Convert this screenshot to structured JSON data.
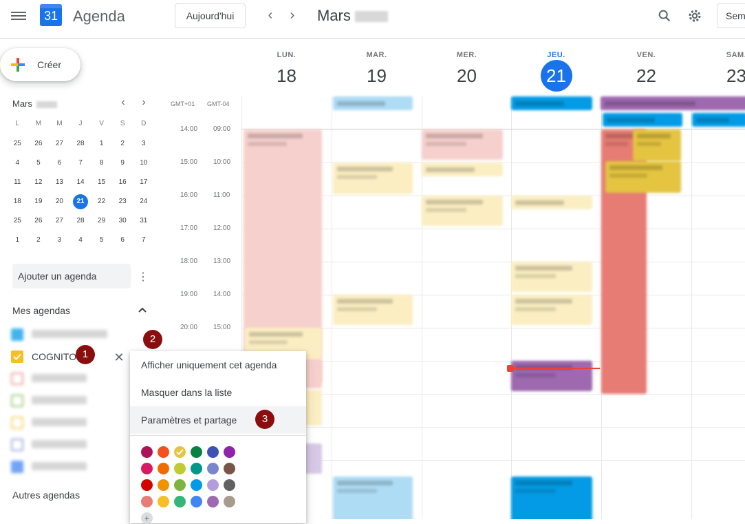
{
  "header": {
    "app_title": "Agenda",
    "logo_text": "31",
    "today_button": "Aujourd'hui",
    "prev_icon": "‹",
    "next_icon": "›",
    "month": "Mars",
    "view_button": "Sem"
  },
  "create": {
    "label": "Créer"
  },
  "mini_calendar": {
    "month": "Mars",
    "weekdays": [
      "L",
      "M",
      "M",
      "J",
      "V",
      "S",
      "D"
    ],
    "weeks": [
      [
        "25",
        "26",
        "27",
        "28",
        "1",
        "2",
        "3"
      ],
      [
        "4",
        "5",
        "6",
        "7",
        "8",
        "9",
        "10"
      ],
      [
        "11",
        "12",
        "13",
        "14",
        "15",
        "16",
        "17"
      ],
      [
        "18",
        "19",
        "20",
        "21",
        "22",
        "23",
        "24"
      ],
      [
        "25",
        "26",
        "27",
        "28",
        "29",
        "30",
        "31"
      ],
      [
        "1",
        "2",
        "3",
        "4",
        "5",
        "6",
        "7"
      ]
    ],
    "today": "21"
  },
  "sidebar": {
    "add_calendar_placeholder": "Ajouter un agenda",
    "my_calendars_title": "Mes agendas",
    "other_calendars_title": "Autres agendas",
    "calendars": [
      {
        "name": "",
        "color": "#039be5",
        "checked": true,
        "blurred": true
      },
      {
        "name": "COGNITO",
        "color": "#f6bf26",
        "checked": true,
        "blurred": false
      },
      {
        "name": "",
        "color": "#e67c73",
        "checked": false,
        "blurred": true
      },
      {
        "name": "",
        "color": "#7cb342",
        "checked": false,
        "blurred": true
      },
      {
        "name": "",
        "color": "#f6bf26",
        "checked": false,
        "blurred": true
      },
      {
        "name": "",
        "color": "#7986cb",
        "checked": false,
        "blurred": true
      },
      {
        "name": "",
        "color": "#4285f4",
        "checked": true,
        "blurred": true
      }
    ]
  },
  "badges": [
    "1",
    "2",
    "3"
  ],
  "context_menu": {
    "items": [
      "Afficher uniquement cet agenda",
      "Masquer dans la liste",
      "Paramètres et partage"
    ],
    "colors": [
      [
        "#ad1457",
        "#f4511e",
        "#e4c441",
        "#0b8043",
        "#3f51b5",
        "#8e24aa"
      ],
      [
        "#d81b60",
        "#ef6c00",
        "#c0ca33",
        "#009688",
        "#7986cb",
        "#795548"
      ],
      [
        "#d50000",
        "#f09300",
        "#7cb342",
        "#039be5",
        "#b39ddb",
        "#616161"
      ],
      [
        "#e67c73",
        "#f6bf26",
        "#33b679",
        "#4285f4",
        "#9e69af",
        "#a79b8e"
      ]
    ],
    "selected_color": "#e4c441"
  },
  "week": {
    "days": [
      {
        "name": "LUN.",
        "num": "18"
      },
      {
        "name": "MAR.",
        "num": "19"
      },
      {
        "name": "MER.",
        "num": "20"
      },
      {
        "name": "JEU.",
        "num": "21",
        "today": true
      },
      {
        "name": "VEN.",
        "num": "22"
      },
      {
        "name": "SAM.",
        "num": "23"
      }
    ],
    "timezones": [
      "GMT+01",
      "GMT-04"
    ],
    "hours": [
      [
        "14:00",
        "09:00"
      ],
      [
        "15:00",
        "10:00"
      ],
      [
        "16:00",
        "11:00"
      ],
      [
        "17:00",
        "12:00"
      ],
      [
        "18:00",
        "13:00"
      ],
      [
        "19:00",
        "14:00"
      ],
      [
        "20:00",
        "15:00"
      ]
    ]
  }
}
